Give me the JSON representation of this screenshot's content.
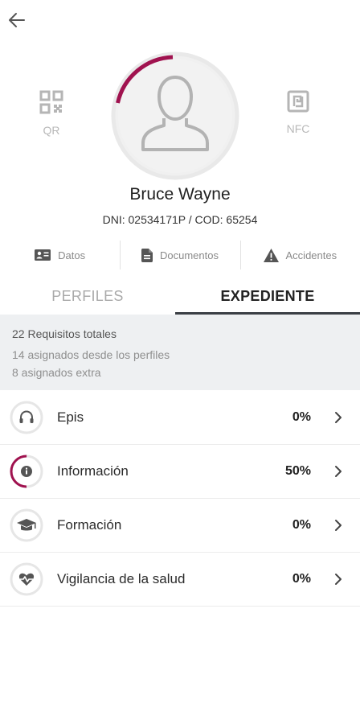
{
  "header": {
    "back_icon": "arrow-left-icon"
  },
  "actions": {
    "qr": {
      "label": "QR",
      "icon": "qr-code-icon"
    },
    "nfc": {
      "label": "NFC",
      "icon": "nfc-icon"
    }
  },
  "profile": {
    "name": "Bruce Wayne",
    "id_line": "DNI: 02534171P / COD: 65254",
    "avatar_icon": "user-placeholder-icon",
    "ring_color": "#a0124f"
  },
  "quick_links": [
    {
      "label": "Datos",
      "icon": "id-card-icon"
    },
    {
      "label": "Documentos",
      "icon": "document-icon"
    },
    {
      "label": "Accidentes",
      "icon": "warning-icon"
    }
  ],
  "tabs": [
    {
      "label": "PERFILES",
      "active": false
    },
    {
      "label": "EXPEDIENTE",
      "active": true
    }
  ],
  "summary": {
    "total": "22 Requisitos totales",
    "from_profiles": "14 asignados desde los perfiles",
    "extra": "8 asignados extra"
  },
  "requirements": [
    {
      "label": "Epis",
      "percent": "0%",
      "progress": 0,
      "icon": "headphones-icon"
    },
    {
      "label": "Información",
      "percent": "50%",
      "progress": 0.5,
      "icon": "info-icon"
    },
    {
      "label": "Formación",
      "percent": "0%",
      "progress": 0,
      "icon": "graduation-cap-icon"
    },
    {
      "label": "Vigilancia de la salud",
      "percent": "0%",
      "progress": 0,
      "icon": "heart-pulse-icon"
    }
  ],
  "colors": {
    "accent": "#a0124f",
    "tab_underline": "#3a3f45",
    "summary_bg": "#eef0f2"
  }
}
